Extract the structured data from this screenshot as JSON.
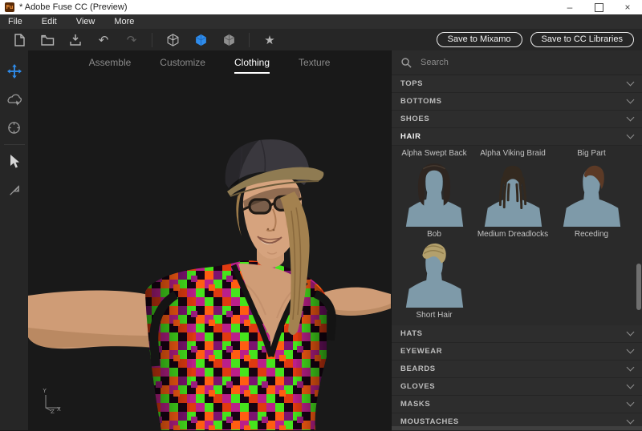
{
  "window": {
    "app_icon": "Fu",
    "title": "* Adobe Fuse CC (Preview)",
    "minimize": "–",
    "close": "×"
  },
  "menu": {
    "items": [
      "File",
      "Edit",
      "View",
      "More"
    ]
  },
  "toolbar": {
    "undo": "↶",
    "redo": "↷",
    "star": "★",
    "save_mixamo": "Save to Mixamo",
    "save_cc": "Save to CC Libraries"
  },
  "tabs": [
    {
      "label": "Assemble",
      "active": false
    },
    {
      "label": "Customize",
      "active": false
    },
    {
      "label": "Clothing",
      "active": true
    },
    {
      "label": "Texture",
      "active": false
    }
  ],
  "viewport": {
    "axis_y": "Y",
    "axis_z": "Z",
    "axis_x": "X"
  },
  "search": {
    "placeholder": "Search"
  },
  "panel": {
    "sections_top": [
      {
        "label": "TOPS",
        "expanded": false
      },
      {
        "label": "BOTTOMS",
        "expanded": false
      },
      {
        "label": "SHOES",
        "expanded": false
      },
      {
        "label": "HAIR",
        "expanded": true
      }
    ],
    "hair_items": [
      {
        "label": "Alpha Swept Back",
        "thumb": "none"
      },
      {
        "label": "Alpha Viking Braid",
        "thumb": "none"
      },
      {
        "label": "Big Part",
        "thumb": "none"
      },
      {
        "label": "Bob",
        "thumb": "bob"
      },
      {
        "label": "Medium Dreadlocks",
        "thumb": "dreadlocks"
      },
      {
        "label": "Receding",
        "thumb": "receding"
      },
      {
        "label": "Short Hair",
        "thumb": "short"
      }
    ],
    "sections_bottom": [
      {
        "label": "HATS",
        "expanded": false
      },
      {
        "label": "EYEWEAR",
        "expanded": false
      },
      {
        "label": "BEARDS",
        "expanded": false
      },
      {
        "label": "GLOVES",
        "expanded": false
      },
      {
        "label": "MASKS",
        "expanded": false
      },
      {
        "label": "MOUSTACHES",
        "expanded": false
      }
    ]
  },
  "colors": {
    "accent_blue": "#2f8ceb",
    "bust": "#7e9aa9",
    "skin": "#cf9c76",
    "cap": "#3a383e",
    "brim": "#8f7b52"
  }
}
